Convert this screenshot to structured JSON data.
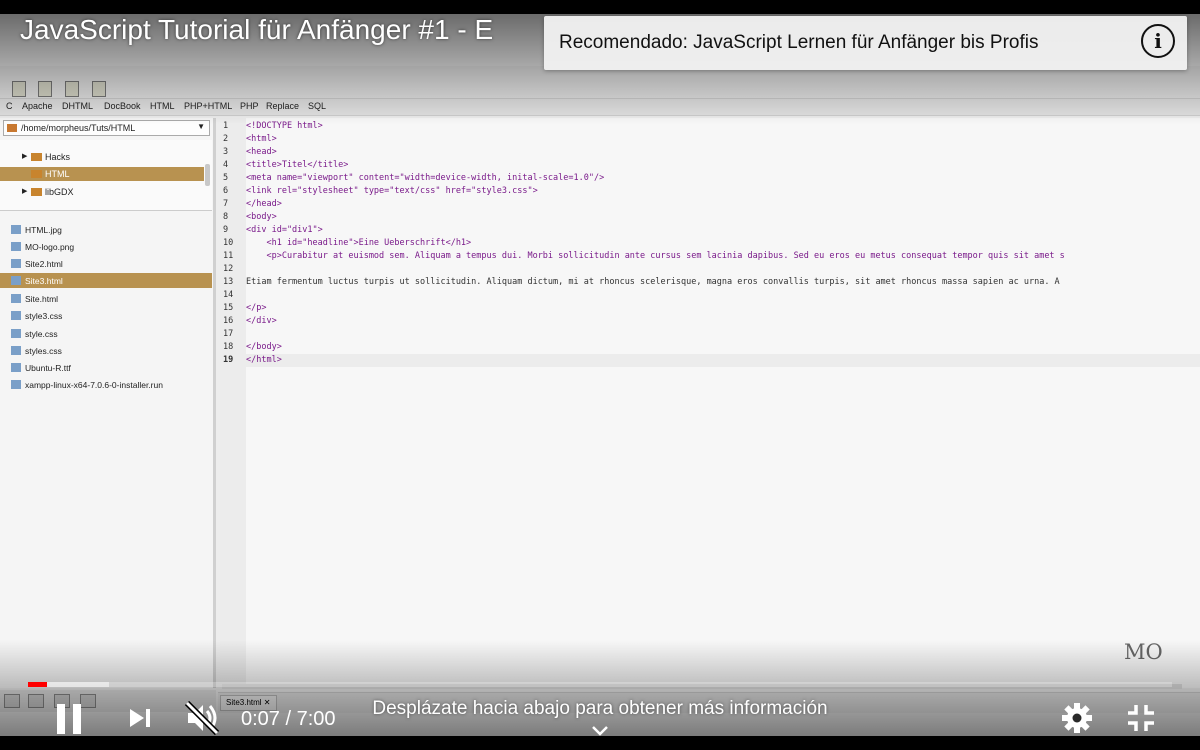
{
  "video": {
    "title": "JavaScript Tutorial für Anfänger #1 - E",
    "recommendation": "Recomendado: JavaScript Lernen für Anfänger bis Profis",
    "watermark": "MO"
  },
  "editor": {
    "menu": [
      "C",
      "Apache",
      "DHTML",
      "DocBook",
      "HTML",
      "PHP+HTML",
      "PHP",
      "Replace",
      "SQL"
    ],
    "path": "/home/morpheus/Tuts/HTML",
    "tree": [
      {
        "label": "Hacks",
        "selected": false
      },
      {
        "label": "HTML",
        "selected": true
      },
      {
        "label": "libGDX",
        "selected": false
      }
    ],
    "files": [
      {
        "label": "HTML.jpg"
      },
      {
        "label": "MO-logo.png"
      },
      {
        "label": "Site2.html"
      },
      {
        "label": "Site3.html",
        "selected": true
      },
      {
        "label": "Site.html"
      },
      {
        "label": "style3.css"
      },
      {
        "label": "style.css"
      },
      {
        "label": "styles.css"
      },
      {
        "label": "Ubuntu-R.ttf"
      },
      {
        "label": "xampp-linux-x64-7.0.6-0-installer.run"
      }
    ],
    "line_numbers": [
      "1",
      "2",
      "3",
      "4",
      "5",
      "6",
      "7",
      "8",
      "9",
      "10",
      "11",
      "12",
      "13",
      "14",
      "15",
      "16",
      "17",
      "18",
      "19"
    ],
    "code_lines": [
      "<!DOCTYPE html>",
      "<html>",
      "<head>",
      "<title>Titel</title>",
      "<meta name=\"viewport\" content=\"width=device-width, inital-scale=1.0\"/>",
      "<link rel=\"stylesheet\" type=\"text/css\" href=\"style3.css\">",
      "</head>",
      "<body>",
      "<div id=\"div1\">",
      "    <h1 id=\"headline\">Eine Ueberschrift</h1>",
      "    <p>Curabitur at euismod sem. Aliquam a tempus dui. Morbi sollicitudin ante cursus sem lacinia dapibus. Sed eu eros eu metus consequat tempor quis sit amet s",
      "",
      "Etiam fermentum luctus turpis ut sollicitudin. Aliquam dictum, mi at rhoncus scelerisque, magna eros convallis turpis, sit amet rhoncus massa sapien ac urna. A",
      "",
      "</p>",
      "</div>",
      "",
      "</body>",
      "</html>"
    ],
    "file_tab": "Site3.html"
  },
  "player": {
    "current_time": "0:07",
    "duration": "7:00",
    "time_display": "0:07 / 7:00",
    "played_fraction": 0.017,
    "buffered_fraction": 0.071,
    "scroll_hint": "Desplázate hacia abajo para obtener más información",
    "icons": [
      "pause-icon",
      "next-icon",
      "mute-icon",
      "settings-icon",
      "exit-fullscreen-icon",
      "chevron-down-icon",
      "info-icon"
    ],
    "accent": "#ff0000"
  }
}
